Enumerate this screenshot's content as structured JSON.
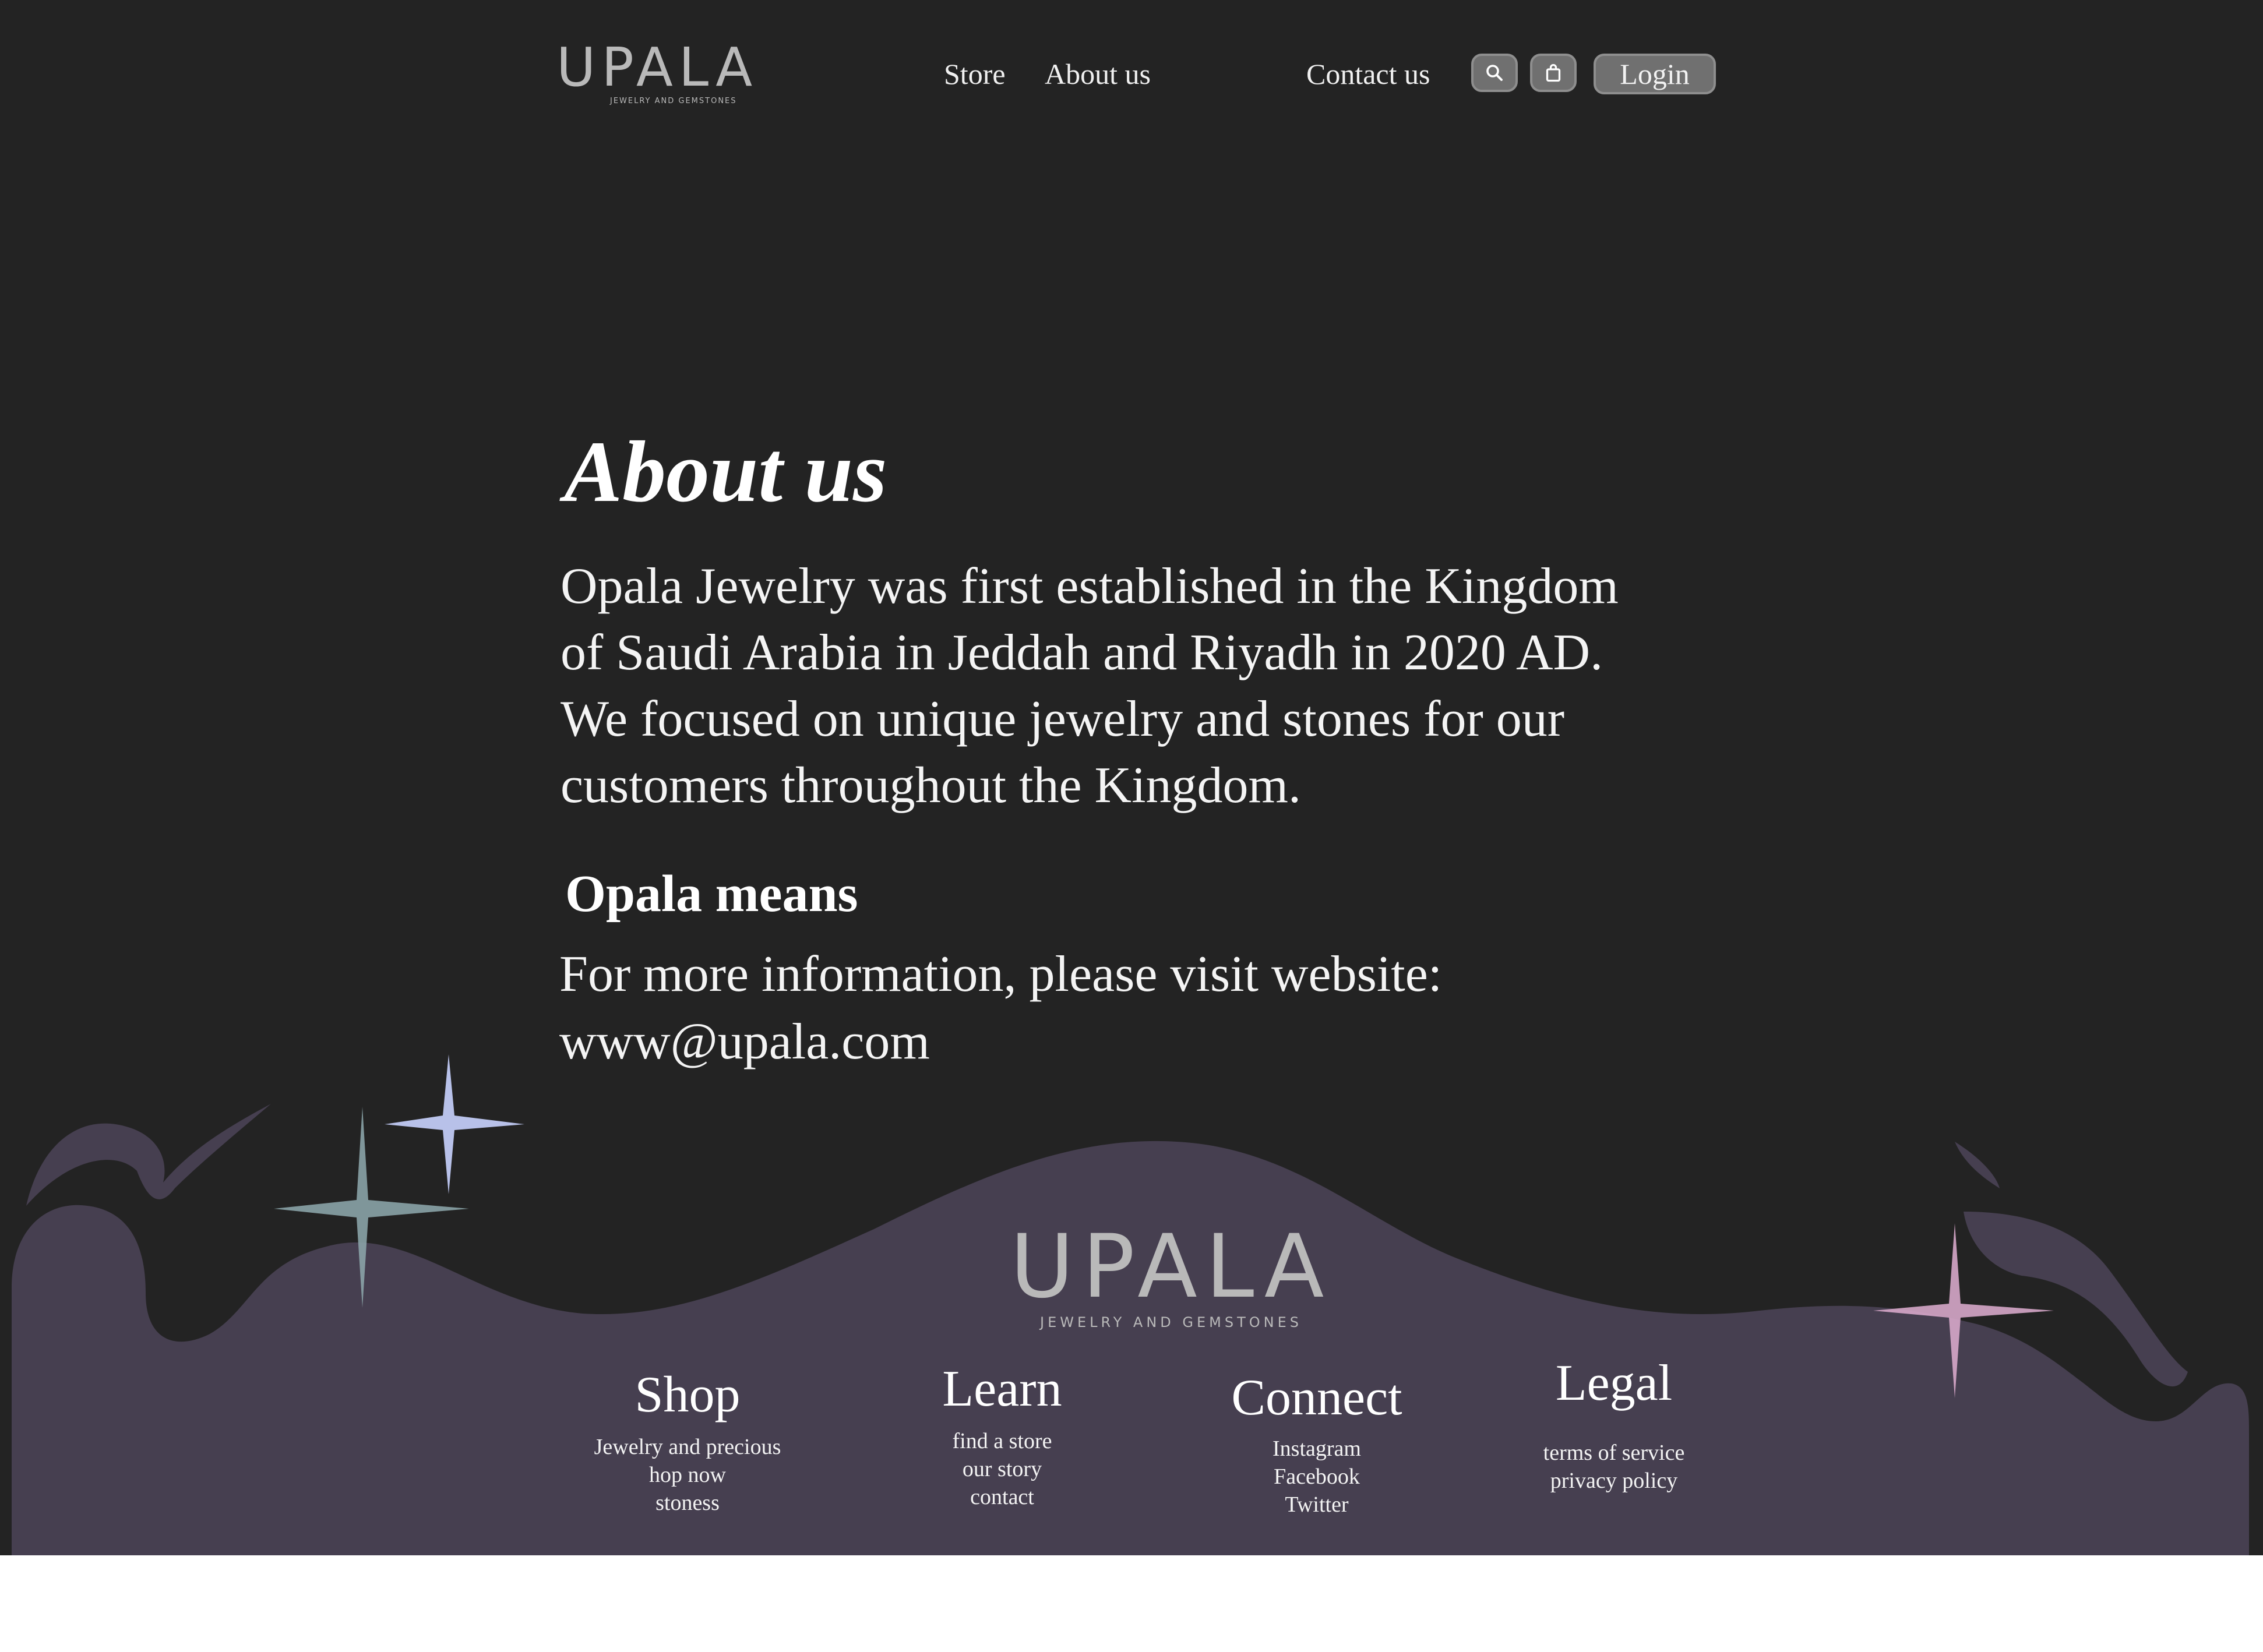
{
  "header": {
    "logo": {
      "wordmark": "UPALA",
      "tagline": "JEWELRY AND GEMSTONES"
    },
    "nav": {
      "store": "Store",
      "about": "About us",
      "contact": "Contact us"
    },
    "icons": {
      "search": "search-icon",
      "cart": "shopping-bag-icon"
    },
    "login_label": "Login"
  },
  "main": {
    "title": "About us",
    "intro_lines": [
      "Opala Jewelry was first established in the Kingdom",
      "of Saudi Arabia in Jeddah and Riyadh in 2020 AD.",
      "We focused on unique jewelry and stones for our",
      "customers throughout the Kingdom."
    ],
    "section_heading": "Opala means",
    "more_info_line1": "For more information, please visit website:",
    "website": "www@upala.com"
  },
  "footer": {
    "logo": {
      "wordmark": "UPALA",
      "tagline": "JEWELRY AND GEMSTONES"
    },
    "columns": [
      {
        "title": "Shop",
        "items": [
          "Jewelry and precious",
          "hop now",
          "stoness"
        ]
      },
      {
        "title": "Learn",
        "items": [
          "find a store",
          "our story",
          "contact"
        ]
      },
      {
        "title": "Connect",
        "items": [
          "Instagram",
          "Facebook",
          "Twitter"
        ]
      },
      {
        "title": "Legal",
        "items": [
          "terms of service",
          "privacy policy"
        ]
      }
    ]
  },
  "colors": {
    "background": "#232323",
    "footer_wave": "#463f50",
    "text": "#ffffff",
    "logo": "#b9b9b9",
    "button": "#707070"
  }
}
